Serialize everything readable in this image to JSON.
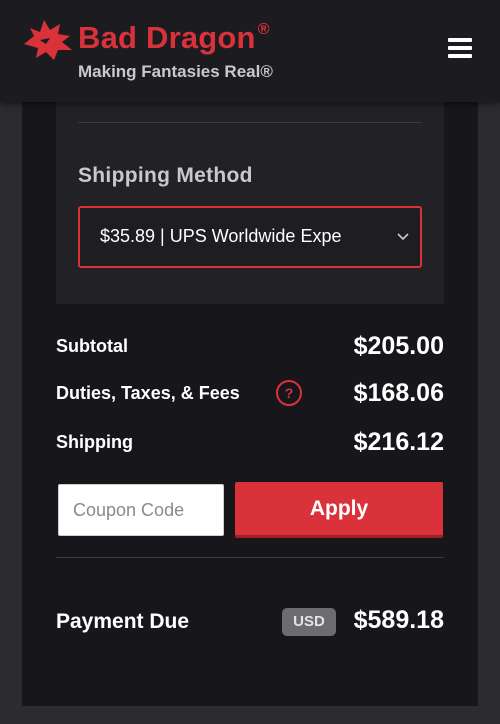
{
  "header": {
    "brand": "Bad Dragon",
    "trademark": "®",
    "tagline": "Making Fantasies Real®",
    "logo_icon": "dragon-head-icon",
    "menu_icon": "hamburger-menu-icon"
  },
  "shipping": {
    "title": "Shipping Method",
    "selected": "$35.89 | UPS Worldwide Expe"
  },
  "summary": {
    "subtotal_label": "Subtotal",
    "subtotal_value": "$205.00",
    "duties_label": "Duties, Taxes, & Fees",
    "duties_help": "?",
    "duties_value": "$168.06",
    "shipping_label": "Shipping",
    "shipping_value": "$216.12"
  },
  "coupon": {
    "placeholder": "Coupon Code",
    "apply_label": "Apply"
  },
  "payment": {
    "label": "Payment Due",
    "currency": "USD",
    "value": "$589.18"
  },
  "colors": {
    "brand_red": "#d9323a",
    "background": "#2c2c30",
    "card": "#17171b",
    "panel": "#222226"
  }
}
